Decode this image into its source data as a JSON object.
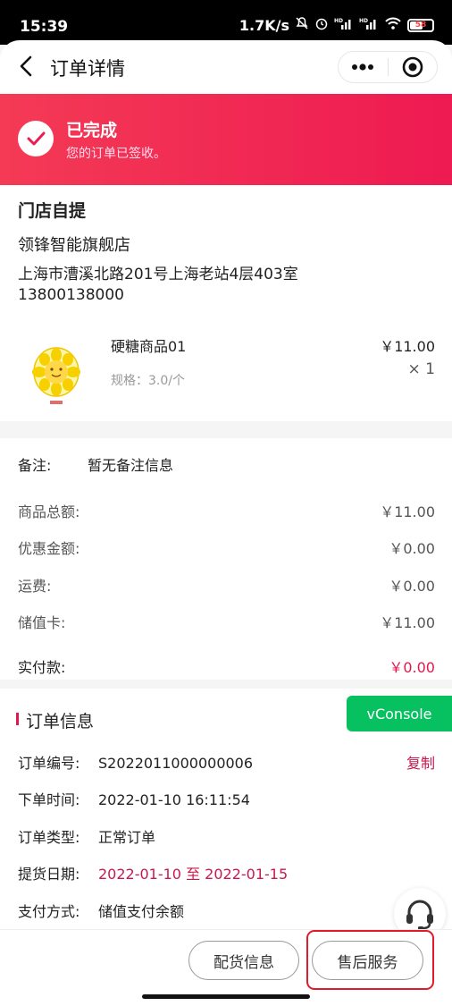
{
  "status_bar": {
    "time": "15:39",
    "network_speed": "1.7K/s",
    "battery": "58",
    "icons": [
      "mute-icon",
      "alarm-icon",
      "hd-signal-icon",
      "hd-signal-icon",
      "wifi-icon",
      "battery-icon"
    ]
  },
  "nav": {
    "title": "订单详情",
    "back_icon": "chevron-left-icon",
    "more_icon": "more-dots-icon",
    "close_icon": "target-circle-icon"
  },
  "order_status": {
    "title": "已完成",
    "subtitle": "您的订单已签收。",
    "icon": "check-icon"
  },
  "pickup": {
    "title": "门店自提",
    "store_name": "领锋智能旗舰店",
    "address": "上海市漕溪北路201号上海老站4层403室",
    "phone": "13800138000"
  },
  "product": {
    "name": "硬糖商品01",
    "spec": "规格：3.0/个",
    "price": "￥11.00",
    "quantity": "× 1",
    "image_icon": "sunflower-candy-image"
  },
  "summary": {
    "remark_label": "备注:",
    "remark_value": "暂无备注信息",
    "rows": [
      {
        "label": "商品总额:",
        "value": "￥11.00"
      },
      {
        "label": "优惠金额:",
        "value": "￥0.00"
      },
      {
        "label": "运费:",
        "value": "￥0.00"
      },
      {
        "label": "储值卡:",
        "value": "￥11.00"
      }
    ],
    "paid_label": "实付款:",
    "paid_value": "￥0.00"
  },
  "order_info": {
    "title": "订单信息",
    "order_no_label": "订单编号:",
    "order_no": "S2022011000000006",
    "copy_label": "复制",
    "order_time_label": "下单时间:",
    "order_time": "2022-01-10 16:11:54",
    "order_type_label": "订单类型:",
    "order_type": "正常订单",
    "pickup_date_label": "提货日期:",
    "pickup_date": "2022-01-10 至 2022-01-15",
    "pay_method_label": "支付方式:",
    "pay_method": "储值支付余额"
  },
  "vconsole_label": "vConsole",
  "customer_service_icon": "headset-icon",
  "actions": {
    "delivery_info": "配货信息",
    "after_sale": "售后服务"
  },
  "colors": {
    "accent": "#e0184d",
    "banner_start": "#f43a55",
    "banner_end": "#ee1a52",
    "vconsole": "#07c160",
    "highlight": "#e21b2a"
  }
}
